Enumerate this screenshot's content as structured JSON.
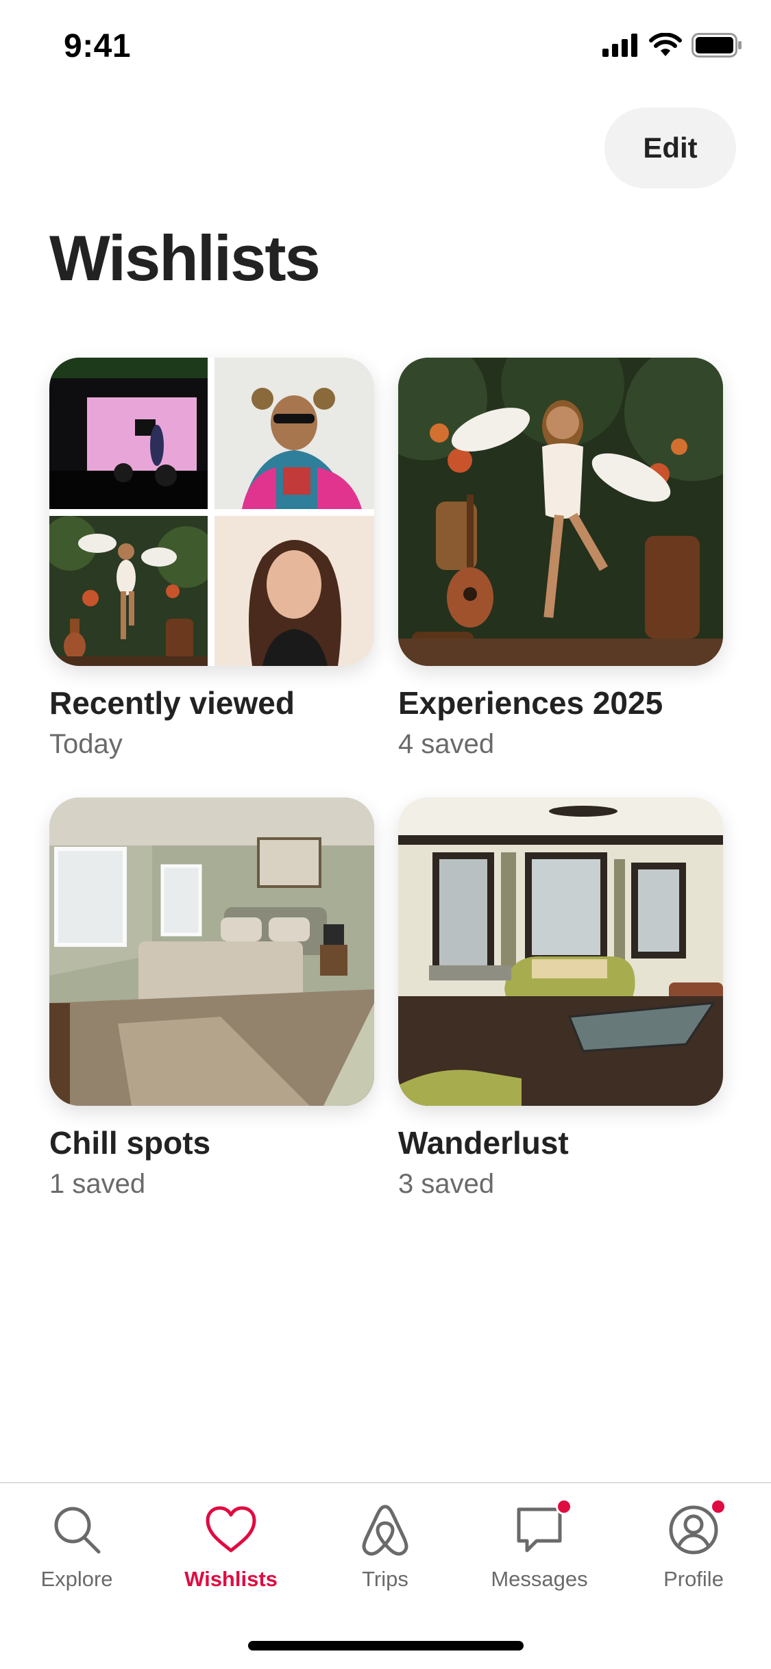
{
  "status_bar": {
    "time": "9:41"
  },
  "header": {
    "edit_label": "Edit",
    "title": "Wishlists"
  },
  "wishlists": [
    {
      "title": "Recently viewed",
      "subtitle": "Today",
      "image": "photo-collage"
    },
    {
      "title": "Experiences 2025",
      "subtitle": "4 saved",
      "image": "performer-photo"
    },
    {
      "title": "Chill spots",
      "subtitle": "1 saved",
      "image": "bedroom-photo"
    },
    {
      "title": "Wanderlust",
      "subtitle": "3 saved",
      "image": "living-room-photo"
    }
  ],
  "tab_bar": {
    "tabs": [
      {
        "label": "Explore",
        "icon": "search-icon",
        "active": false,
        "badge": false
      },
      {
        "label": "Wishlists",
        "icon": "heart-icon",
        "active": true,
        "badge": false
      },
      {
        "label": "Trips",
        "icon": "airbnb-logo-icon",
        "active": false,
        "badge": false
      },
      {
        "label": "Messages",
        "icon": "message-icon",
        "active": false,
        "badge": true
      },
      {
        "label": "Profile",
        "icon": "profile-icon",
        "active": false,
        "badge": true
      }
    ]
  },
  "colors": {
    "accent": "#E00B41",
    "text": "#222222",
    "muted": "#6A6A6A"
  }
}
